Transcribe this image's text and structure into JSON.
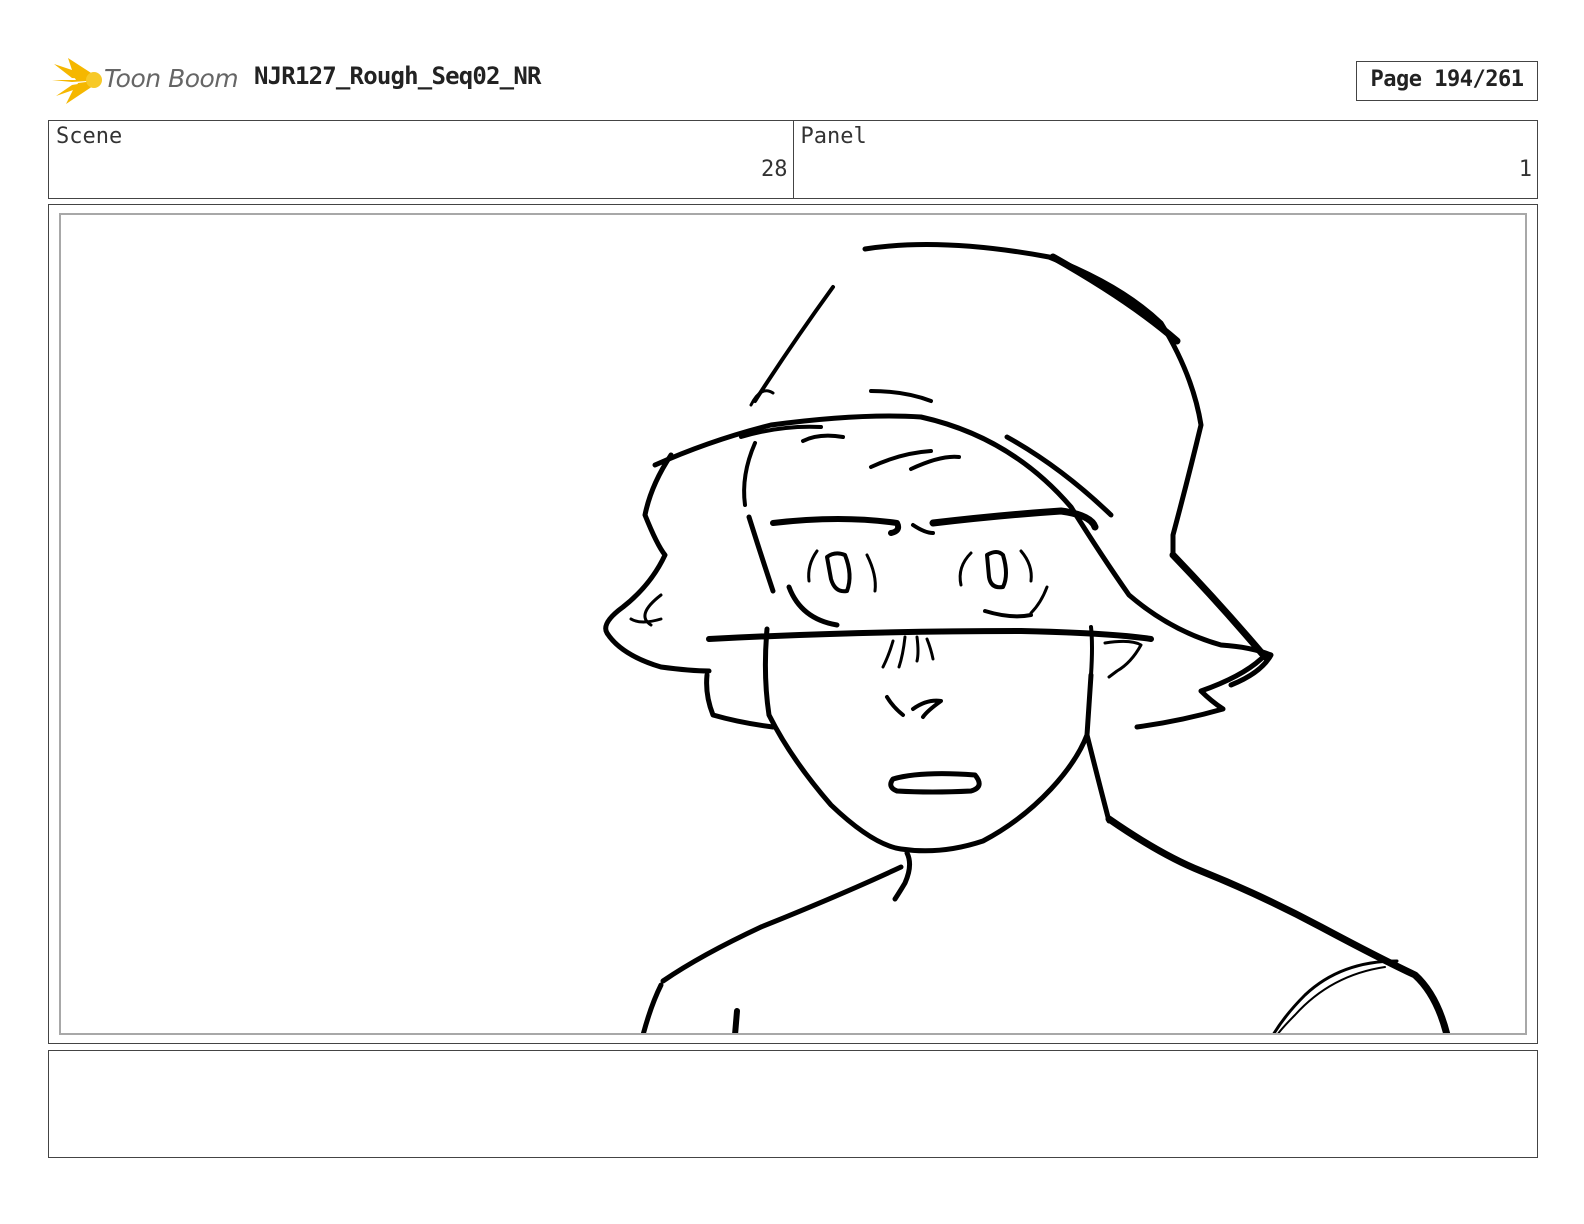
{
  "header": {
    "logo_text": "Toon Boom",
    "project_title": "NJR127_Rough_Seq02_NR",
    "page_label": "Page 194/261"
  },
  "info": {
    "scene_label": "Scene",
    "scene_value": "28",
    "panel_label": "Panel",
    "panel_value": "1"
  },
  "notes": {
    "text": ""
  },
  "colors": {
    "logo_accent": "#f5b700",
    "border": "#444444",
    "panel_inner_border": "#a8a8a8",
    "ink": "#000000"
  }
}
